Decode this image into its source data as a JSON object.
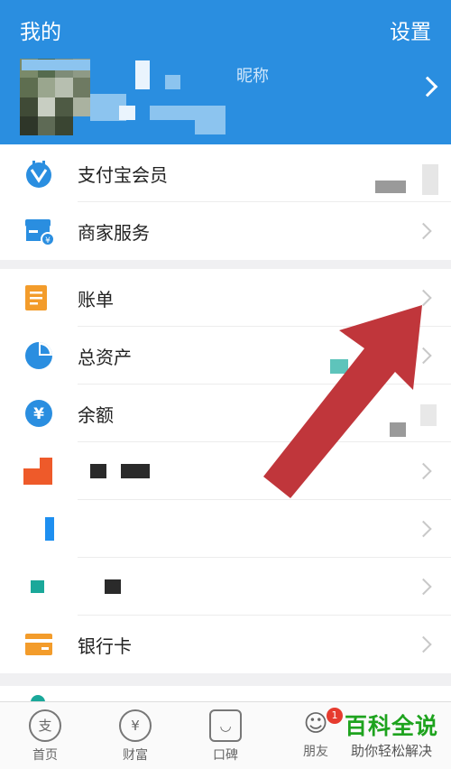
{
  "header": {
    "title": "我的",
    "settings": "设置",
    "nickname": "昵称"
  },
  "sections": {
    "top": [
      {
        "label": "支付宝会员",
        "icon": "member-icon"
      },
      {
        "label": "商家服务",
        "icon": "merchant-icon"
      }
    ],
    "main": [
      {
        "label": "账单",
        "icon": "bill-icon"
      },
      {
        "label": "总资产",
        "icon": "assets-pie-icon"
      },
      {
        "label": "余额",
        "icon": "balance-yuan-icon"
      },
      {
        "label": "",
        "icon": "orange-icon"
      },
      {
        "label": "",
        "icon": "blue-icon"
      },
      {
        "label": "",
        "icon": "teal-icon"
      },
      {
        "label": "银行卡",
        "icon": "bank-card-icon"
      }
    ]
  },
  "tabbar": [
    {
      "label": "首页",
      "glyph": "支"
    },
    {
      "label": "财富",
      "glyph": "¥"
    },
    {
      "label": "口碑",
      "glyph": "◡"
    },
    {
      "label": "朋友",
      "glyph": "☺",
      "badge": "1"
    },
    {
      "label": "",
      "glyph": ""
    }
  ],
  "watermark": {
    "main": "百科全说",
    "sub": "助你轻松解决"
  },
  "colors": {
    "header": "#2a8ee0",
    "arrow": "#c0363b",
    "accent_orange": "#f39c2b"
  }
}
